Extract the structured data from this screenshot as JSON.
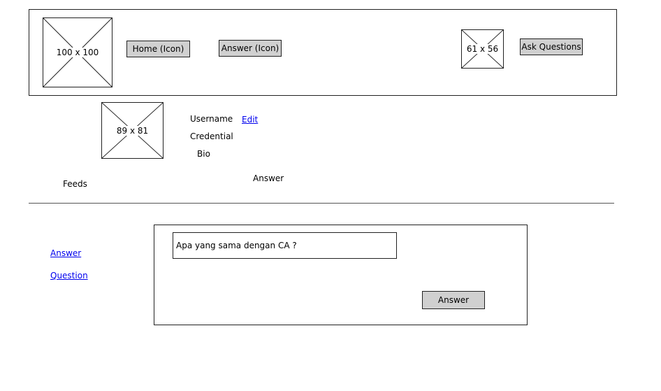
{
  "header": {
    "logo_label": "100 x 100",
    "home_button_label": "Home (Icon)",
    "answer_button_label": "Answer (Icon)",
    "avatar_label": "61 x 56",
    "ask_button_label": "Ask Questions"
  },
  "profile": {
    "photo_label": "89 x 81",
    "username": "Username",
    "edit_link": "Edit",
    "credential": "Credential",
    "bio": "Bio"
  },
  "sections": {
    "feeds_label": "Feeds",
    "answer_label": "Answer"
  },
  "sidebar": {
    "answer_link": "Answer",
    "question_link": "Question"
  },
  "answer_panel": {
    "question_text": "Apa yang sama dengan CA ?",
    "answer_button_label": "Answer"
  },
  "colors": {
    "button_fill": "#d0d0d0",
    "link": "#0000ee",
    "border": "#222222"
  }
}
